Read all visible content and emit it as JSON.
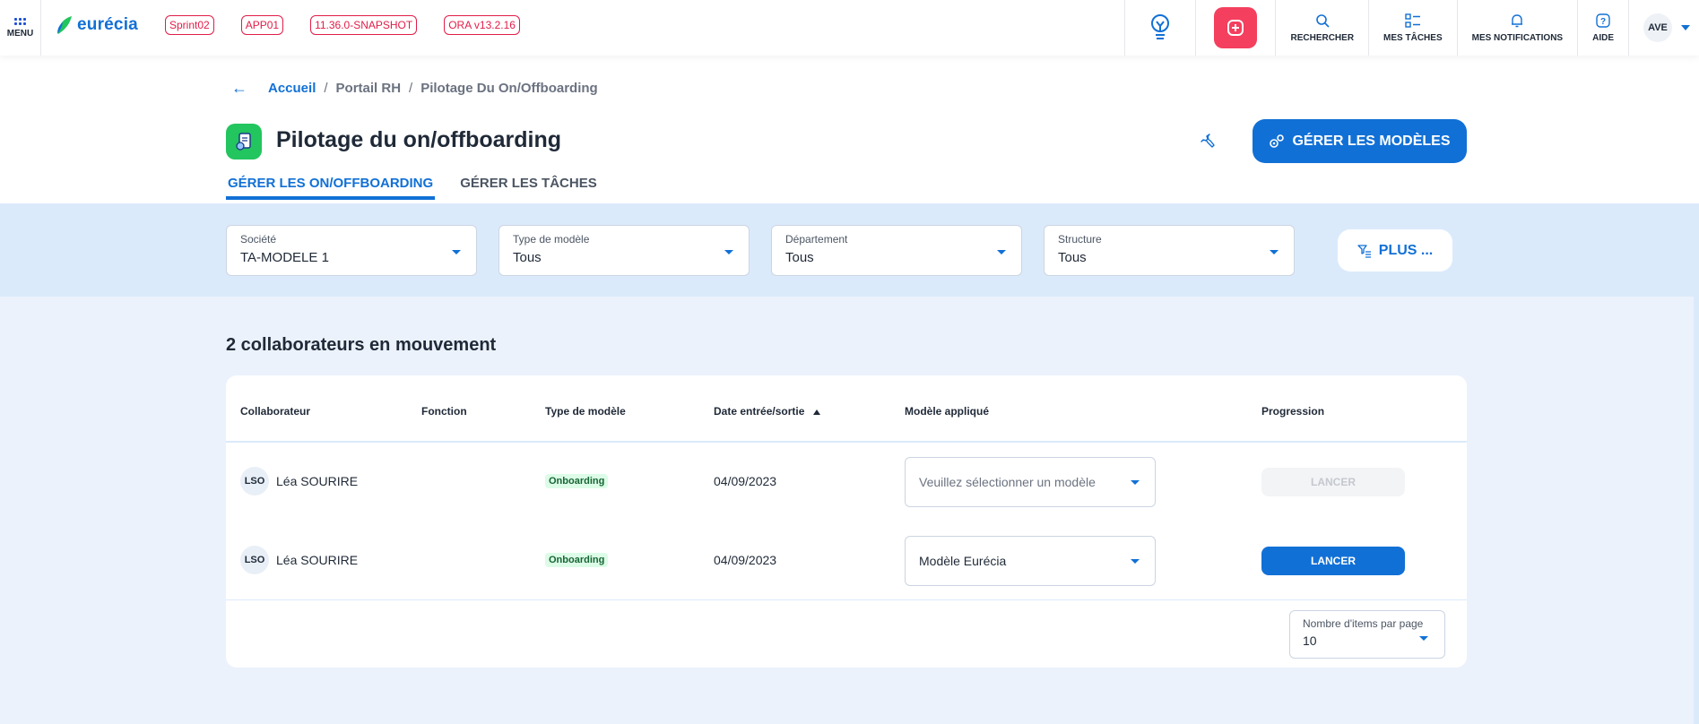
{
  "topbar": {
    "menu_label": "MENU",
    "logo_text": "eurécia",
    "env_badges": [
      "Sprint02",
      "APP01",
      "11.36.0-SNAPSHOT",
      "ORA v13.2.16"
    ],
    "actions": {
      "search_label": "RECHERCHER",
      "tasks_label": "MES TÂCHES",
      "notifications_label": "MES NOTIFICATIONS",
      "help_label": "AIDE"
    },
    "user_initials": "AVE"
  },
  "breadcrumb": {
    "home": "Accueil",
    "section": "Portail RH",
    "current": "Pilotage Du On/Offboarding"
  },
  "page": {
    "title": "Pilotage du on/offboarding",
    "manage_models_label": "GÉRER LES MODÈLES"
  },
  "tabs": [
    {
      "label": "GÉRER LES ON/OFFBOARDING",
      "active": true
    },
    {
      "label": "GÉRER LES TÂCHES",
      "active": false
    }
  ],
  "filters": [
    {
      "label": "Société",
      "value": "TA-MODELE 1"
    },
    {
      "label": "Type de modèle",
      "value": "Tous"
    },
    {
      "label": "Département",
      "value": "Tous"
    },
    {
      "label": "Structure",
      "value": "Tous"
    }
  ],
  "more_filters_label": "PLUS ...",
  "list": {
    "count_title": "2 collaborateurs en mouvement",
    "columns": [
      "Collaborateur",
      "Fonction",
      "Type de modèle",
      "Date entrée/sortie",
      "Modèle appliqué",
      "Progression"
    ],
    "rows": [
      {
        "initials": "LSO",
        "name": "Léa SOURIRE",
        "function": "",
        "type": "Onboarding",
        "date": "04/09/2023",
        "model": "Veuillez sélectionner un modèle",
        "model_placeholder": true,
        "action": "LANCER",
        "action_enabled": false
      },
      {
        "initials": "LSO",
        "name": "Léa SOURIRE",
        "function": "",
        "type": "Onboarding",
        "date": "04/09/2023",
        "model": "Modèle Eurécia",
        "model_placeholder": false,
        "action": "LANCER",
        "action_enabled": true
      }
    ],
    "per_page_label": "Nombre d'items par page",
    "per_page_value": "10"
  },
  "colors": {
    "primary": "#1170d6",
    "accent_red": "#f43f5e",
    "page_bg": "#ebf2fc",
    "filter_bg": "#dbeafb"
  }
}
